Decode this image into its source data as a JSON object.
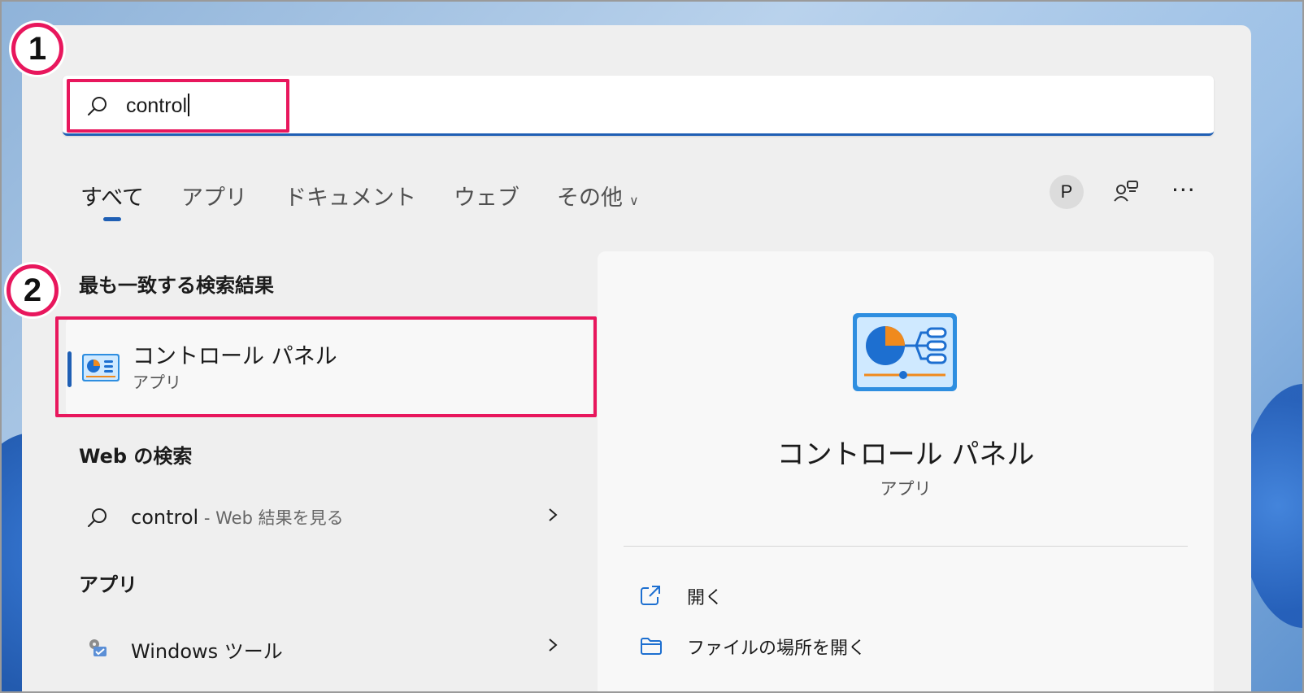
{
  "search": {
    "query": "control"
  },
  "tabs": [
    {
      "label": "すべて",
      "active": true
    },
    {
      "label": "アプリ"
    },
    {
      "label": "ドキュメント"
    },
    {
      "label": "ウェブ"
    },
    {
      "label": "その他"
    }
  ],
  "header": {
    "avatar_initial": "P",
    "more_label": "···"
  },
  "badges": {
    "one": "1",
    "two": "2"
  },
  "sections": {
    "best_match": "最も一致する検索結果",
    "web_search": "Web の検索",
    "apps": "アプリ"
  },
  "best_match": {
    "name": "コントロール パネル",
    "type": "アプリ"
  },
  "web_result": {
    "query": "control",
    "suffix": " - Web 結果を見る"
  },
  "app_result": {
    "name": "Windows ツール"
  },
  "detail": {
    "name": "コントロール パネル",
    "type": "アプリ",
    "actions": [
      {
        "label": "開く"
      },
      {
        "label": "ファイルの場所を開く"
      }
    ]
  },
  "colors": {
    "accent": "#1f5fb4",
    "highlight": "#e8175d",
    "panel": "#efefef"
  }
}
